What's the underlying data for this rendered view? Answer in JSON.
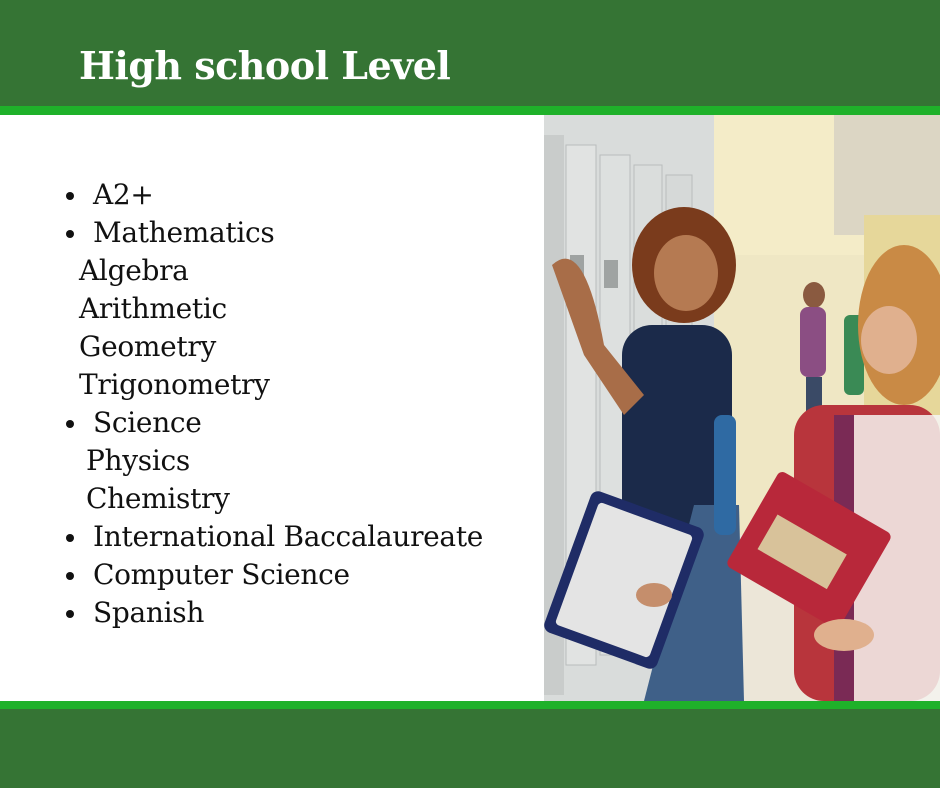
{
  "slide": {
    "title": "High school Level",
    "items": [
      {
        "text": "A2+",
        "kind": "bullet"
      },
      {
        "text": "Mathematics",
        "kind": "bullet"
      },
      {
        "text": "Algebra",
        "kind": "sub1"
      },
      {
        "text": "Arithmetic",
        "kind": "sub1"
      },
      {
        "text": "Geometry",
        "kind": "sub1"
      },
      {
        "text": "Trigonometry",
        "kind": "sub1"
      },
      {
        "text": "Science",
        "kind": "bullet"
      },
      {
        "text": "Physics",
        "kind": "sub2"
      },
      {
        "text": "Chemistry",
        "kind": "sub2"
      },
      {
        "text": "International Baccalaureate",
        "kind": "bullet"
      },
      {
        "text": "Computer Science",
        "kind": "bullet"
      },
      {
        "text": "Spanish",
        "kind": "bullet"
      }
    ]
  },
  "colors": {
    "header_green": "#357434",
    "stripe_green": "#1fb12a"
  }
}
